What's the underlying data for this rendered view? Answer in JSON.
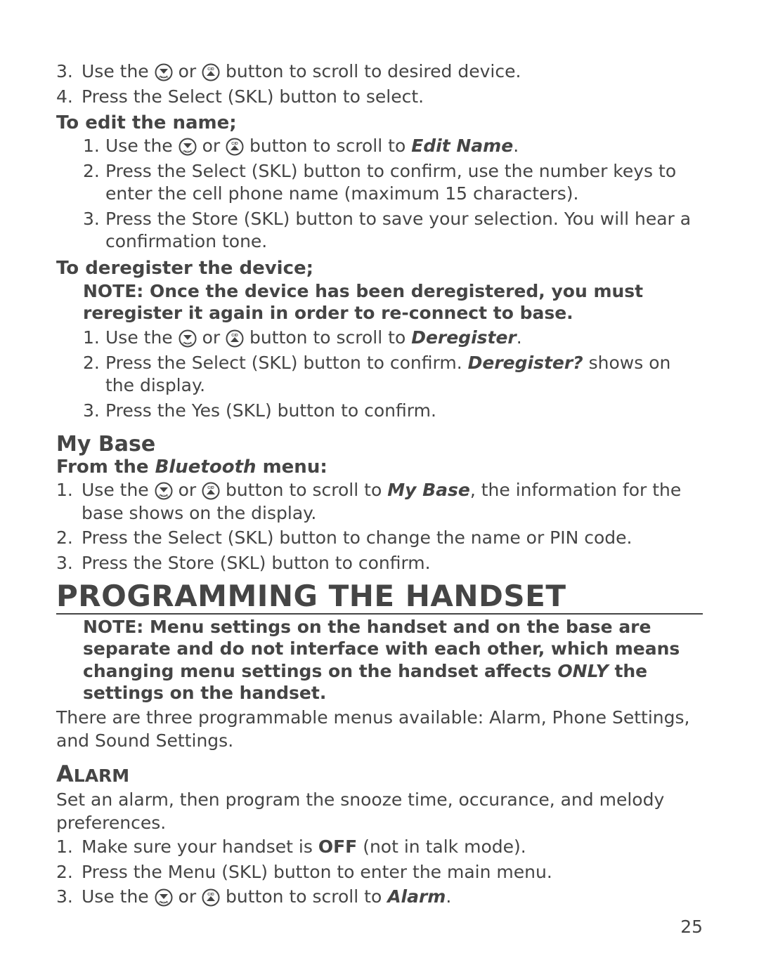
{
  "page_number": "25",
  "icons": {
    "down_label": "REDIAL",
    "up_label": "CID"
  },
  "top_list": {
    "item3": {
      "num": "3.",
      "pre": "Use the ",
      "or": " or ",
      "post": " button to scroll to desired device."
    },
    "item4": {
      "num": "4.",
      "text": "Press the Select (SKL) button to select."
    }
  },
  "edit_name": {
    "heading": "To edit the name;",
    "item1": {
      "num": "1.",
      "pre": "Use the ",
      "or": " or ",
      "post": " button to scroll to ",
      "target": "Edit Name",
      "end": "."
    },
    "item2": {
      "num": "2.",
      "text": "Press the Select (SKL) button to confirm, use the number keys to enter the cell phone name (maximum 15 characters)."
    },
    "item3": {
      "num": "3.",
      "text": "Press the Store (SKL) button to save your selection. You will hear a confirmation tone."
    }
  },
  "deregister": {
    "heading": "To deregister the device;",
    "note": "NOTE: Once the device has been deregistered, you must reregister it again in order to re-connect to base.",
    "item1": {
      "num": "1.",
      "pre": "Use the ",
      "or": " or ",
      "post": " button to scroll to ",
      "target": "Deregister",
      "end": "."
    },
    "item2": {
      "num": "2.",
      "pre": "Press the Select (SKL) button to confirm. ",
      "target": "Deregister?",
      "post": " shows on the display."
    },
    "item3": {
      "num": "3.",
      "text": "Press the Yes (SKL) button to confirm."
    }
  },
  "my_base": {
    "heading": "My Base",
    "sub_pre": "From the ",
    "sub_target": "Bluetooth",
    "sub_post": " menu:",
    "item1": {
      "num": "1.",
      "pre": "Use the ",
      "or": " or ",
      "post": " button to scroll to ",
      "target": "My Base",
      "end": ", the information for the base shows on the display."
    },
    "item2": {
      "num": "2.",
      "text": "Press the Select (SKL) button to change the name or PIN code."
    },
    "item3": {
      "num": "3.",
      "text": "Press the Store (SKL) button to confirm."
    }
  },
  "programming": {
    "heading": "PROGRAMMING THE HANDSET",
    "note_a": "NOTE: Menu settings on the handset and on the base are separate and do not interface with each other, which means changing menu settings on the handset affects ",
    "note_only": "ONLY",
    "note_b": " the settings on the handset.",
    "body": "There are three programmable menus available: Alarm, Phone Settings, and Sound Settings."
  },
  "alarm": {
    "heading_first": "A",
    "heading_rest": "LARM",
    "body": "Set an alarm, then program the snooze time, occurance, and melody preferences.",
    "item1": {
      "num": "1.",
      "pre": "Make sure your handset is ",
      "bold": "OFF",
      "post": " (not in talk mode)."
    },
    "item2": {
      "num": "2.",
      "text": "Press the Menu (SKL) button to enter the main menu."
    },
    "item3": {
      "num": "3.",
      "pre": "Use the ",
      "or": " or ",
      "post": " button to scroll to ",
      "target": "Alarm",
      "end": "."
    }
  }
}
